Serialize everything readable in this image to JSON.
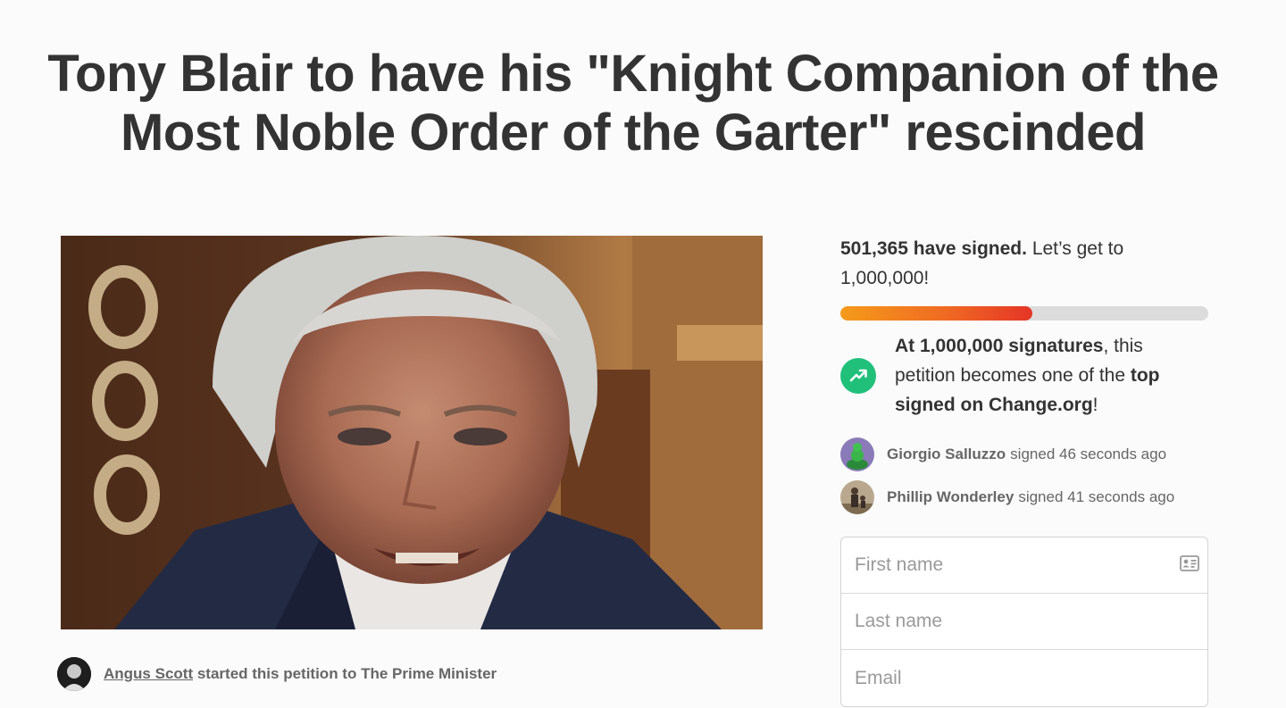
{
  "petition": {
    "title": "Tony Blair to have his \"Knight Companion of the Most Noble Order of the Garter\" rescinded"
  },
  "starter": {
    "name": "Angus Scott",
    "text": "started this petition to The Prime Minister"
  },
  "signatures": {
    "count_text": "501,365 have signed.",
    "goal_text": "Let’s get to 1,000,000!",
    "progress_fraction": 0.5014,
    "milestone_bold": "At 1,000,000 signatures",
    "milestone_mid": ", this petition becomes one of the ",
    "milestone_bold2": "top signed on Change.org",
    "milestone_end": "!",
    "milestone_icon": "trending-up-icon"
  },
  "recent_signers": [
    {
      "name": "Giorgio Salluzzo",
      "text": "signed 46 seconds ago"
    },
    {
      "name": "Phillip Wonderley",
      "text": "signed 41 seconds ago"
    }
  ],
  "form": {
    "first_name_placeholder": "First name",
    "last_name_placeholder": "Last name",
    "email_placeholder": "Email",
    "contact_card_icon": "contact-card-icon"
  },
  "colors": {
    "progress_start": "#f59b1a",
    "progress_end": "#e43526",
    "milestone_icon_bg": "#20c07b"
  }
}
